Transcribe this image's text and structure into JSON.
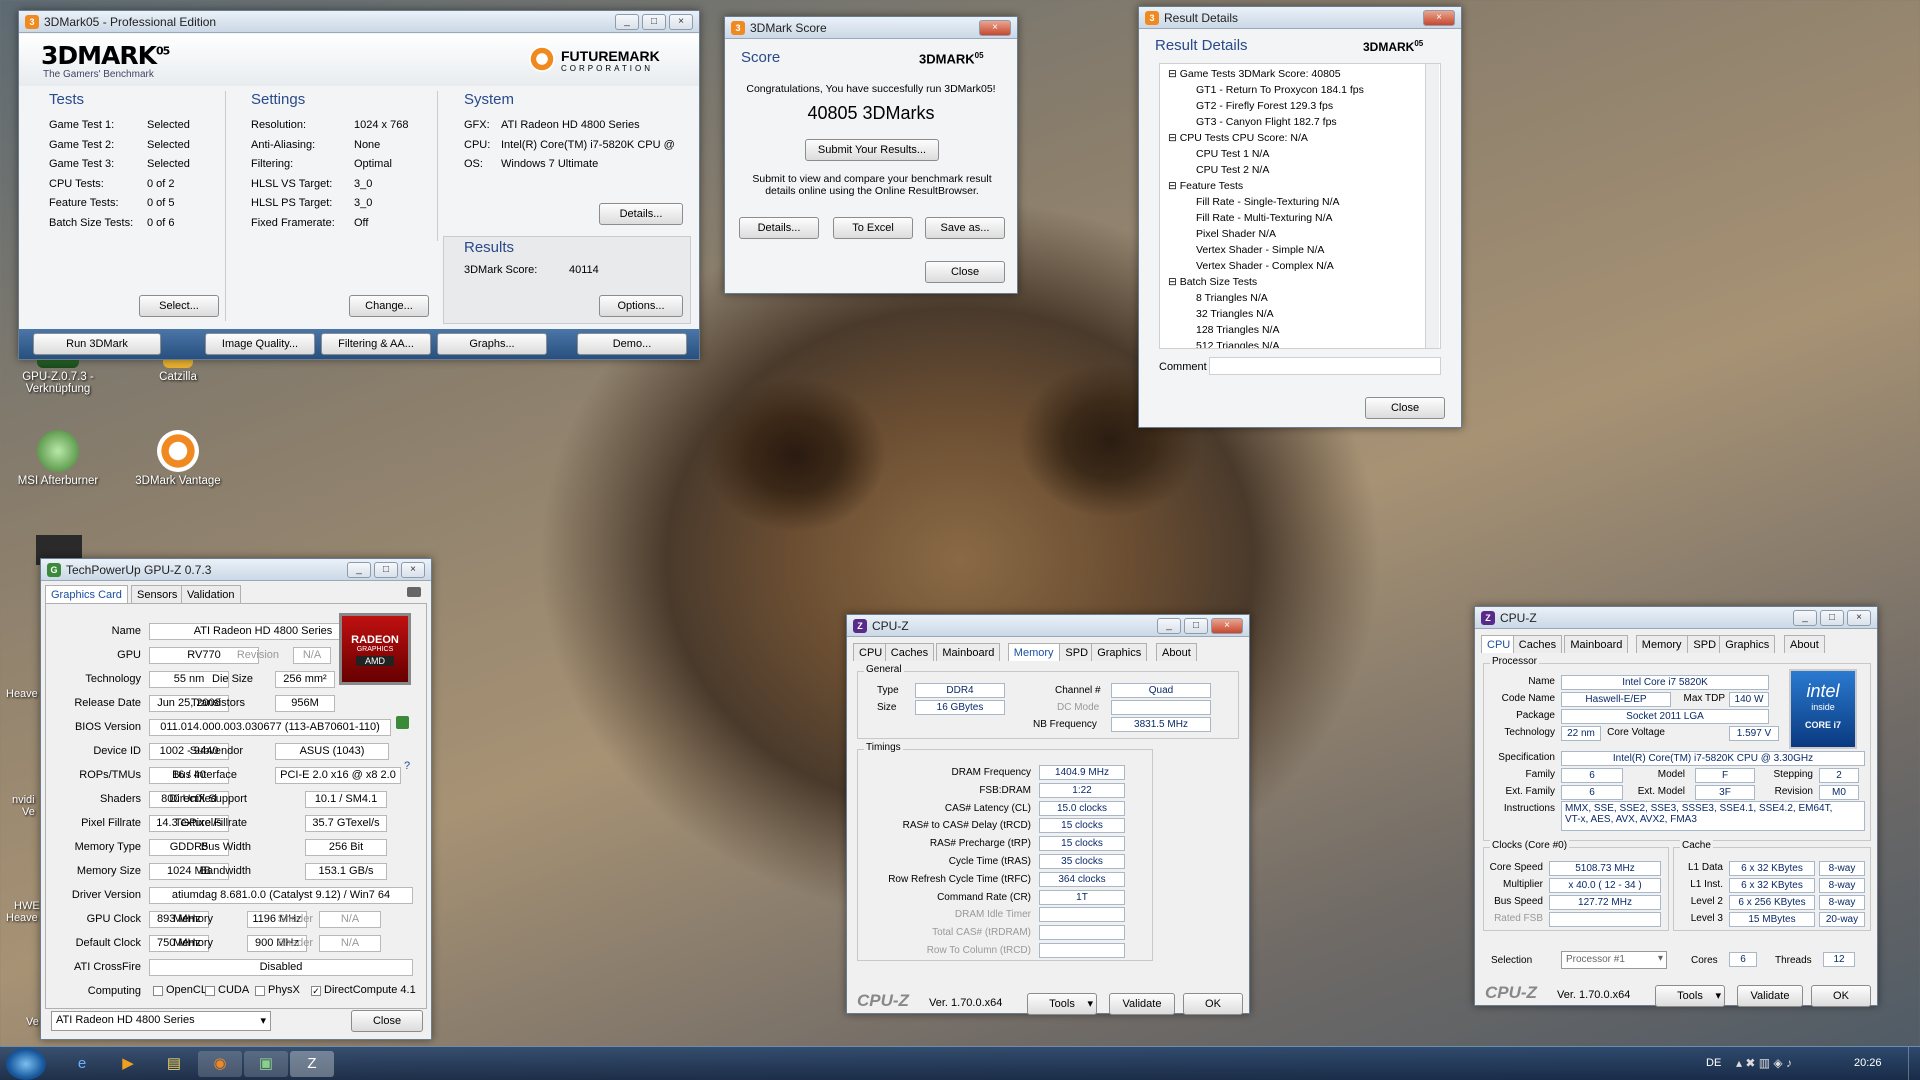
{
  "desktop": {
    "icons": [
      {
        "label": "GPU-Z.0.7.3 -\nVerknüpfung"
      },
      {
        "label": "Catzilla"
      },
      {
        "label": "MSI Afterburner"
      },
      {
        "label": "3DMark Vantage"
      }
    ],
    "edge_labels": [
      "Heave",
      "nvidi",
      "Ve",
      "HWE",
      "Heave",
      "Ve"
    ]
  },
  "m05": {
    "title": "3DMark05 - Professional Edition",
    "logo": "3DMARK",
    "logo_sup": "05",
    "tagline": "The Gamers' Benchmark",
    "fm": "FUTUREMARK",
    "fm_sub": "CORPORATION",
    "tests_h": "Tests",
    "tests": [
      [
        "Game Test 1:",
        "Selected"
      ],
      [
        "Game Test 2:",
        "Selected"
      ],
      [
        "Game Test 3:",
        "Selected"
      ],
      [
        "CPU Tests:",
        "0 of 2"
      ],
      [
        "Feature Tests:",
        "0 of 5"
      ],
      [
        "Batch Size Tests:",
        "0 of 6"
      ]
    ],
    "settings_h": "Settings",
    "settings": [
      [
        "Resolution:",
        "1024 x 768"
      ],
      [
        "Anti-Aliasing:",
        "None"
      ],
      [
        "Filtering:",
        "Optimal"
      ],
      [
        "HLSL VS Target:",
        "3_0"
      ],
      [
        "HLSL PS Target:",
        "3_0"
      ],
      [
        "Fixed Framerate:",
        "Off"
      ]
    ],
    "system_h": "System",
    "system": [
      [
        "GFX:",
        "ATI Radeon HD 4800 Series"
      ],
      [
        "CPU:",
        "Intel(R) Core(TM) i7-5820K CPU @"
      ],
      [
        "OS:",
        "Windows 7 Ultimate"
      ]
    ],
    "results_h": "Results",
    "score_label": "3DMark Score:",
    "score": "40114",
    "btn_details": "Details...",
    "btn_select": "Select...",
    "btn_change": "Change...",
    "btn_options": "Options...",
    "bottom": [
      "Run 3DMark",
      "Image Quality...",
      "Filtering & AA...",
      "Graphs...",
      "Demo..."
    ]
  },
  "score": {
    "title": "3DMark Score",
    "h": "Score",
    "logo": "3DMARK",
    "logo_sup": "05",
    "congrats": "Congratulations, You have succesfully run 3DMark05!",
    "marks": "40805 3DMarks",
    "submit": "Submit Your Results...",
    "info": "Submit to view and compare your benchmark result details online using the Online ResultBrowser.",
    "b1": "Details...",
    "b2": "To Excel",
    "b3": "Save as...",
    "close": "Close"
  },
  "rd": {
    "title": "Result Details",
    "h": "Result Details",
    "logo": "3DMARK",
    "logo_sup": "05",
    "tree": [
      {
        "t": "Game Tests   3DMark Score: 40805",
        "l": 0
      },
      {
        "t": "GT1 - Return To Proxycon   184.1 fps",
        "l": 1
      },
      {
        "t": "GT2 - Firefly Forest   129.3 fps",
        "l": 1
      },
      {
        "t": "GT3 - Canyon Flight   182.7 fps",
        "l": 1
      },
      {
        "t": "CPU Tests   CPU Score: N/A",
        "l": 0
      },
      {
        "t": "CPU Test 1   N/A",
        "l": 1
      },
      {
        "t": "CPU Test 2   N/A",
        "l": 1
      },
      {
        "t": "Feature Tests",
        "l": 0
      },
      {
        "t": "Fill Rate - Single-Texturing   N/A",
        "l": 1
      },
      {
        "t": "Fill Rate - Multi-Texturing   N/A",
        "l": 1
      },
      {
        "t": "Pixel Shader   N/A",
        "l": 1
      },
      {
        "t": "Vertex Shader - Simple   N/A",
        "l": 1
      },
      {
        "t": "Vertex Shader - Complex   N/A",
        "l": 1
      },
      {
        "t": "Batch Size Tests",
        "l": 0
      },
      {
        "t": "8 Triangles   N/A",
        "l": 1
      },
      {
        "t": "32 Triangles   N/A",
        "l": 1
      },
      {
        "t": "128 Triangles   N/A",
        "l": 1
      },
      {
        "t": "512 Triangles   N/A",
        "l": 1
      }
    ],
    "comment": "Comment",
    "close": "Close"
  },
  "gpuz": {
    "title": "TechPowerUp GPU-Z 0.7.3",
    "tabs": [
      "Graphics Card",
      "Sensors",
      "Validation"
    ],
    "name_l": "Name",
    "name": "ATI Radeon HD 4800 Series",
    "gpu_l": "GPU",
    "gpu": "RV770",
    "rev_l": "Revision",
    "rev": "N/A",
    "tech_l": "Technology",
    "tech": "55 nm",
    "die_l": "Die Size",
    "die": "256 mm²",
    "rel_l": "Release Date",
    "rel": "Jun 25, 2008",
    "tr_l": "Transistors",
    "tr": "956M",
    "bios_l": "BIOS Version",
    "bios": "011.014.000.003.030677 (113-AB70601-110)",
    "dev_l": "Device ID",
    "dev": "1002 - 9440",
    "sub_l": "Subvendor",
    "sub": "ASUS (1043)",
    "rops_l": "ROPs/TMUs",
    "rops": "16 / 40",
    "bus_l": "Bus Interface",
    "bus": "PCI-E 2.0 x16 @ x8 2.0",
    "q": "?",
    "sh_l": "Shaders",
    "sh": "800 Unified",
    "dx_l": "DirectX Support",
    "dx": "10.1 / SM4.1",
    "pf_l": "Pixel Fillrate",
    "pf": "14.3 GPixel/s",
    "tf_l": "Texture Fillrate",
    "tf": "35.7 GTexel/s",
    "mt_l": "Memory Type",
    "mt": "GDDR5",
    "bw_l": "Bus Width",
    "bw": "256 Bit",
    "ms_l": "Memory Size",
    "ms": "1024 MB",
    "bd_l": "Bandwidth",
    "bd": "153.1 GB/s",
    "drv_l": "Driver Version",
    "drv": "atiumdag 8.681.0.0 (Catalyst 9.12) / Win7 64",
    "gc_l": "GPU Clock",
    "gc": "893 MHz",
    "m1_l": "Memory",
    "m1": "1196 MHz",
    "s1_l": "Shader",
    "s1": "N/A",
    "dc_l": "Default Clock",
    "dc": "750 MHz",
    "m2_l": "Memory",
    "m2": "900 MHz",
    "s2_l": "Shader",
    "s2": "N/A",
    "cf_l": "ATI CrossFire",
    "cf": "Disabled",
    "comp_l": "Computing",
    "opencl": "OpenCL",
    "cuda": "CUDA",
    "physx": "PhysX",
    "dcomp": "DirectCompute 4.1",
    "sel": "ATI Radeon HD 4800 Series",
    "close": "Close",
    "badge1": "RADEON",
    "badge2": "GRAPHICS",
    "badge3": "AMD"
  },
  "cpuzm": {
    "title": "CPU-Z",
    "tabs": [
      "CPU",
      "Caches",
      "Mainboard",
      "Memory",
      "SPD",
      "Graphics",
      "About"
    ],
    "active": "Memory",
    "general": "General",
    "type_l": "Type",
    "type": "DDR4",
    "ch_l": "Channel #",
    "ch": "Quad",
    "size_l": "Size",
    "size": "16 GBytes",
    "dcm_l": "DC Mode",
    "nb_l": "NB Frequency",
    "nb": "3831.5 MHz",
    "timings": "Timings",
    "rows": [
      [
        "DRAM Frequency",
        "1404.9 MHz"
      ],
      [
        "FSB:DRAM",
        "1:22"
      ],
      [
        "CAS# Latency (CL)",
        "15.0 clocks"
      ],
      [
        "RAS# to CAS# Delay (tRCD)",
        "15 clocks"
      ],
      [
        "RAS# Precharge (tRP)",
        "15 clocks"
      ],
      [
        "Cycle Time (tRAS)",
        "35 clocks"
      ],
      [
        "Row Refresh Cycle Time (tRFC)",
        "364 clocks"
      ],
      [
        "Command Rate (CR)",
        "1T"
      ],
      [
        "DRAM Idle Timer",
        ""
      ],
      [
        "Total CAS# (tRDRAM)",
        ""
      ],
      [
        "Row To Column (tRCD)",
        ""
      ]
    ],
    "brand": "CPU-Z",
    "ver": "Ver. 1.70.0.x64",
    "tools": "Tools",
    "validate": "Validate",
    "ok": "OK"
  },
  "cpuzc": {
    "title": "CPU-Z",
    "tabs": [
      "CPU",
      "Caches",
      "Mainboard",
      "Memory",
      "SPD",
      "Graphics",
      "About"
    ],
    "active": "CPU",
    "proc": "Processor",
    "name_l": "Name",
    "name": "Intel Core i7 5820K",
    "cn_l": "Code Name",
    "cn": "Haswell-E/EP",
    "tdp_l": "Max TDP",
    "tdp": "140 W",
    "pkg_l": "Package",
    "pkg": "Socket 2011 LGA",
    "tech_l": "Technology",
    "tech": "22 nm",
    "cv_l": "Core Voltage",
    "cv": "1.597 V",
    "spec_l": "Specification",
    "spec": "Intel(R) Core(TM) i7-5820K CPU @ 3.30GHz",
    "fam_l": "Family",
    "fam": "6",
    "mod_l": "Model",
    "mod": "F",
    "step_l": "Stepping",
    "step": "2",
    "ef_l": "Ext. Family",
    "ef": "6",
    "em_l": "Ext. Model",
    "em": "3F",
    "rev_l": "Revision",
    "rev": "M0",
    "ins_l": "Instructions",
    "ins1": "MMX, SSE, SSE2, SSE3, SSSE3, SSE4.1, SSE4.2, EM64T,",
    "ins2": "VT-x, AES, AVX, AVX2, FMA3",
    "clocks": "Clocks (Core #0)",
    "cs_l": "Core Speed",
    "cs": "5108.73 MHz",
    "mul_l": "Multiplier",
    "mul": "x 40.0 ( 12 - 34 )",
    "bs_l": "Bus Speed",
    "bs": "127.72 MHz",
    "rf_l": "Rated FSB",
    "cache": "Cache",
    "l1d_l": "L1 Data",
    "l1d": "6 x 32 KBytes",
    "l1d_w": "8-way",
    "l1i_l": "L1 Inst.",
    "l1i": "6 x 32 KBytes",
    "l1i_w": "8-way",
    "l2_l": "Level 2",
    "l2": "6 x 256 KBytes",
    "l2_w": "8-way",
    "l3_l": "Level 3",
    "l3": "15 MBytes",
    "l3_w": "20-way",
    "sel_l": "Selection",
    "sel": "Processor #1",
    "cores_l": "Cores",
    "cores": "6",
    "thr_l": "Threads",
    "thr": "12",
    "intel1": "intel",
    "intel2": "inside",
    "intel3": "CORE i7",
    "brand": "CPU-Z",
    "ver": "Ver. 1.70.0.x64",
    "tools": "Tools",
    "validate": "Validate",
    "ok": "OK"
  },
  "taskbar": {
    "lang": "DE",
    "time": "20:26"
  }
}
